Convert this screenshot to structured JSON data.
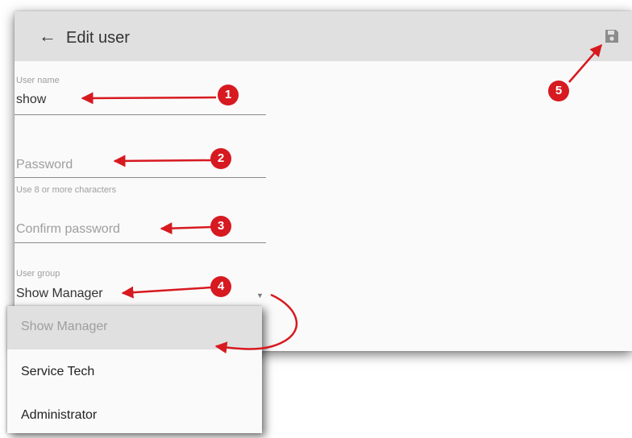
{
  "header": {
    "back_icon": "←",
    "title": "Edit user",
    "save_icon": "save-icon"
  },
  "form": {
    "username": {
      "label": "User name",
      "value": "show"
    },
    "password": {
      "placeholder": "Password",
      "helper": "Use 8 or more characters"
    },
    "confirm": {
      "placeholder": "Confirm password"
    },
    "group": {
      "label": "User group",
      "value": "Show Manager",
      "caret": "▼"
    }
  },
  "menu": {
    "options": [
      "Show Manager",
      "Service Tech",
      "Administrator"
    ]
  },
  "callouts": [
    "1",
    "2",
    "3",
    "4",
    "5"
  ],
  "colors": {
    "accent": "#d71920",
    "header_bg": "#e0e0e0"
  }
}
